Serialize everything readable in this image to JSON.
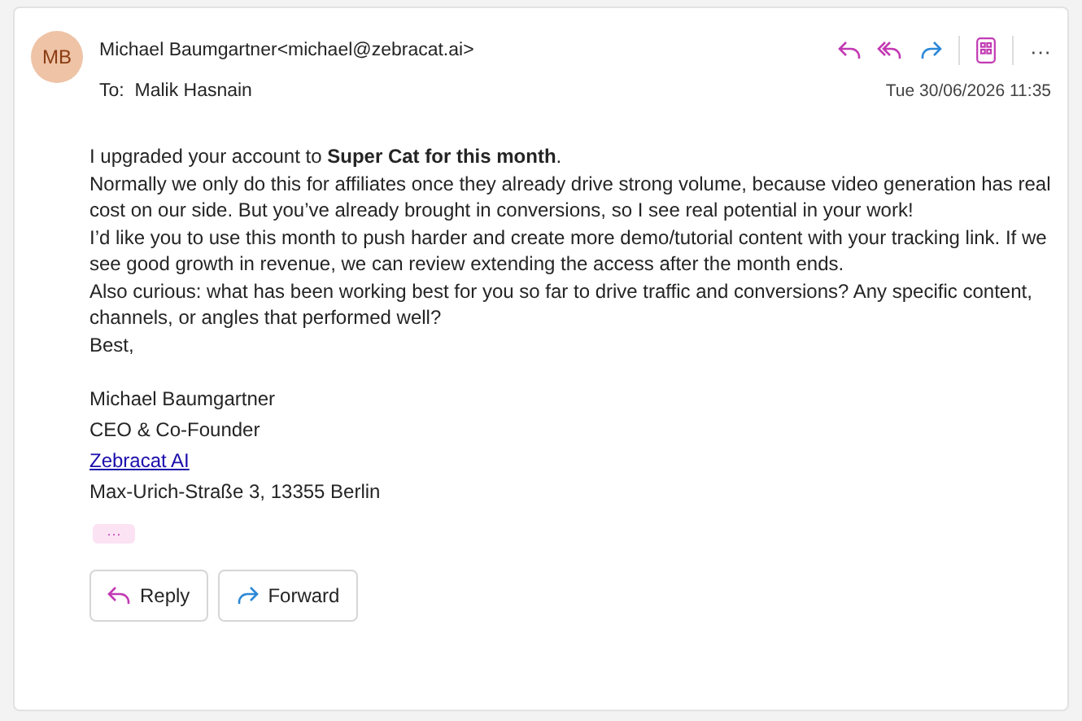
{
  "message": {
    "avatar": "MB",
    "sender_name": "Michael Baumgartner",
    "sender_email": "<michael@zebracat.ai>",
    "to_label": "To:",
    "to": "Malik Hasnain",
    "date": "Tue 30/06/2026 11:35",
    "more": "···"
  },
  "body": [
    "I upgraded your account to **Super Cat for this month**.",
    "Normally we only do this for affiliates once they already drive strong volume, because video generation has real cost on our side. But you’ve already brought in conversions, so I see real potential in your work!",
    "I’d like you to use this month to push harder and create more demo/tutorial content with your tracking link. If we see good growth in revenue, we can review extending the access after the month ends.",
    "Also curious: what has been working best for you so far to drive traffic and conversions? Any specific content, channels, or angles that performed well?",
    "Best,"
  ],
  "signature": [
    {
      "kind": "text",
      "text": "Michael Baumgartner"
    },
    {
      "kind": "text",
      "text": "CEO & Co-Founder"
    },
    {
      "kind": "link",
      "text": "Zebracat AI"
    },
    {
      "kind": "text",
      "text": "Max-Urich-Straße 3, 13355 Berlin"
    }
  ],
  "expand": "···",
  "buttons": [
    {
      "kind": "reply",
      "label": "Reply"
    },
    {
      "kind": "forward",
      "label": "Forward"
    }
  ]
}
